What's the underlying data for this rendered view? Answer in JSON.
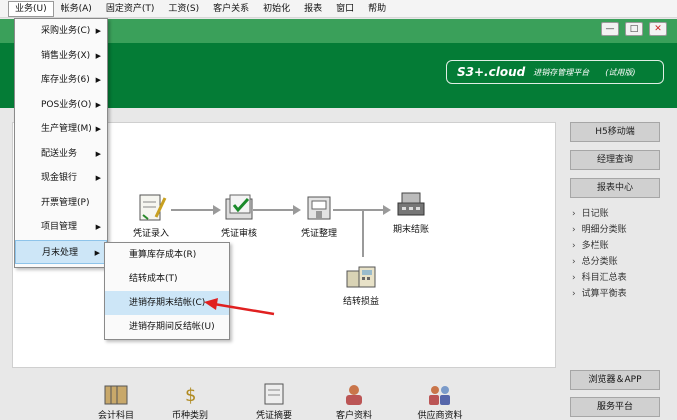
{
  "menubar": {
    "items": [
      {
        "label": "业务(U)",
        "active": true
      },
      {
        "label": "帐务(A)"
      },
      {
        "label": "固定资产(T)"
      },
      {
        "label": "工资(S)"
      },
      {
        "label": "客户关系"
      },
      {
        "label": "初始化"
      },
      {
        "label": "报表"
      },
      {
        "label": "窗口"
      },
      {
        "label": "帮助"
      }
    ]
  },
  "window_controls": {
    "minimize": "—",
    "restore": "□",
    "close": "✕"
  },
  "brand": {
    "logo": "S3+.cloud",
    "subtitle": "进销存管理平台",
    "edition": "(试用版)"
  },
  "dropdown": {
    "items": [
      {
        "label": "采购业务(C)",
        "submenu": true
      },
      {
        "label": "销售业务(X)",
        "submenu": true
      },
      {
        "label": "库存业务(6)",
        "submenu": true
      },
      {
        "label": "POS业务(O)",
        "submenu": true
      },
      {
        "label": "生产管理(M)",
        "submenu": true
      },
      {
        "label": "配送业务",
        "submenu": true
      },
      {
        "label": "现金银行",
        "submenu": true
      },
      {
        "label": "开票管理(P)",
        "submenu": false
      },
      {
        "label": "项目管理",
        "submenu": true
      },
      {
        "label": "月末处理",
        "submenu": true,
        "highlighted": true
      }
    ]
  },
  "submenu": {
    "items": [
      {
        "label": "重算库存成本(R)"
      },
      {
        "label": "结转成本(T)"
      },
      {
        "label": "进销存期末结帐(C)",
        "highlighted": true
      },
      {
        "label": "进销存期间反结帐(U)"
      }
    ]
  },
  "flow": {
    "voucher_entry": "凭证录入",
    "voucher_review": "凭证审核",
    "voucher_arrange": "凭证整理",
    "period_close": "期末结账",
    "profit_transfer": "结转损益"
  },
  "right_panel": {
    "h5": "H5移动端",
    "manager_query": "经理查询",
    "report_center": "报表中心",
    "links": [
      "日记账",
      "明细分类账",
      "多栏账",
      "总分类账",
      "科目汇总表",
      "试算平衡表"
    ],
    "browser_app": "浏览器＆APP",
    "service": "服务平台"
  },
  "bottom": {
    "items": [
      "会计科目",
      "币种类别",
      "凭证摘要",
      "客户资料",
      "供应商资料"
    ]
  },
  "colors": {
    "header_green": "#047c36",
    "title_green": "#3aa05a",
    "arrow_red": "#e02020"
  }
}
